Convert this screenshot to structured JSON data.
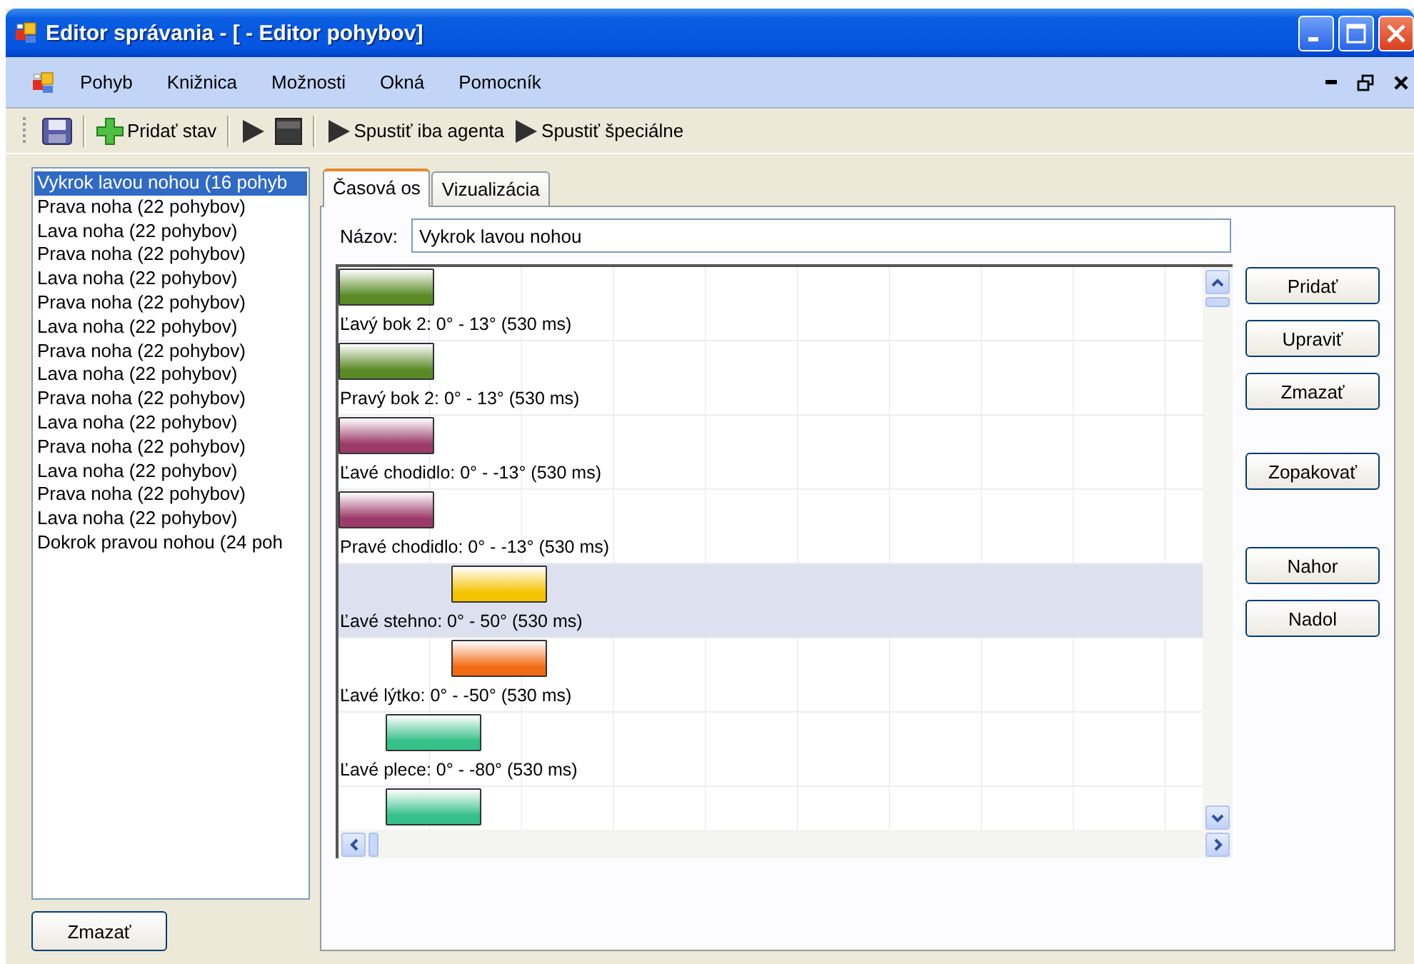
{
  "window": {
    "title": "Editor správania - [ - Editor pohybov]"
  },
  "menu": [
    "Pohyb",
    "Knižnica",
    "Možnosti",
    "Okná",
    "Pomocník"
  ],
  "toolbar": [
    {
      "kind": "save"
    },
    {
      "kind": "separator"
    },
    {
      "kind": "add",
      "label": "Pridať stav"
    },
    {
      "kind": "separator"
    },
    {
      "kind": "play"
    },
    {
      "kind": "stop"
    },
    {
      "kind": "separator"
    },
    {
      "kind": "play",
      "label": "Spustiť iba agenta"
    },
    {
      "kind": "play",
      "label": "Spustiť špeciálne"
    }
  ],
  "motions": [
    {
      "label": "Vykrok lavou nohou (16 pohyb",
      "selected": true
    },
    {
      "label": "Prava noha (22 pohybov)",
      "selected": false
    },
    {
      "label": "Lava noha (22 pohybov)",
      "selected": false
    },
    {
      "label": "Prava noha (22 pohybov)",
      "selected": false
    },
    {
      "label": "Lava noha (22 pohybov)",
      "selected": false
    },
    {
      "label": "Prava noha (22 pohybov)",
      "selected": false
    },
    {
      "label": "Lava noha (22 pohybov)",
      "selected": false
    },
    {
      "label": "Prava noha (22 pohybov)",
      "selected": false
    },
    {
      "label": "Lava noha (22 pohybov)",
      "selected": false
    },
    {
      "label": "Prava noha (22 pohybov)",
      "selected": false
    },
    {
      "label": "Lava noha (22 pohybov)",
      "selected": false
    },
    {
      "label": "Prava noha (22 pohybov)",
      "selected": false
    },
    {
      "label": "Lava noha (22 pohybov)",
      "selected": false
    },
    {
      "label": "Prava noha (22 pohybov)",
      "selected": false
    },
    {
      "label": "Lava noha (22 pohybov)",
      "selected": false
    },
    {
      "label": "Dokrok pravou nohou (24 poh",
      "selected": false
    }
  ],
  "list_button": "Zmazať",
  "tabs": [
    {
      "label": "Časová os",
      "selected": true
    },
    {
      "label": "Vizualizácia",
      "selected": false
    }
  ],
  "name_field": {
    "label": "Názov:",
    "value": "Vykrok lavou nohou"
  },
  "tracks": [
    {
      "label": "Ľavý bok 2: 0° - 13° (530 ms)",
      "color": "#5a8a26",
      "kind": "start",
      "selected": false
    },
    {
      "label": "Pravý bok 2: 0° - 13° (530 ms)",
      "color": "#5a8a26",
      "kind": "start",
      "selected": false
    },
    {
      "label": "Ľavé chodidlo: 0° - -13° (530 ms)",
      "color": "#9c3a6a",
      "kind": "start",
      "selected": false
    },
    {
      "label": "Pravé chodidlo: 0° - -13° (530 ms)",
      "color": "#9c3a6a",
      "kind": "start",
      "selected": false
    },
    {
      "label": "Ľavé stehno: 0° - 50° (530 ms)",
      "color": "#f5c400",
      "kind": "late",
      "selected": true
    },
    {
      "label": "Ľavé lýtko: 0° - -50° (530 ms)",
      "color": "#f26a12",
      "kind": "late",
      "selected": false
    },
    {
      "label": "Ľavé plece: 0° - -80° (530 ms)",
      "color": "#36c08a",
      "kind": "middle",
      "selected": false
    },
    {
      "color": "#36c08a",
      "kind": "middle",
      "selected": false
    }
  ],
  "button_groups": [
    [
      "Pridať",
      "Upraviť",
      "Zmazať"
    ],
    [
      "Zopakovať"
    ],
    [
      "Nahor",
      "Nadol"
    ]
  ]
}
